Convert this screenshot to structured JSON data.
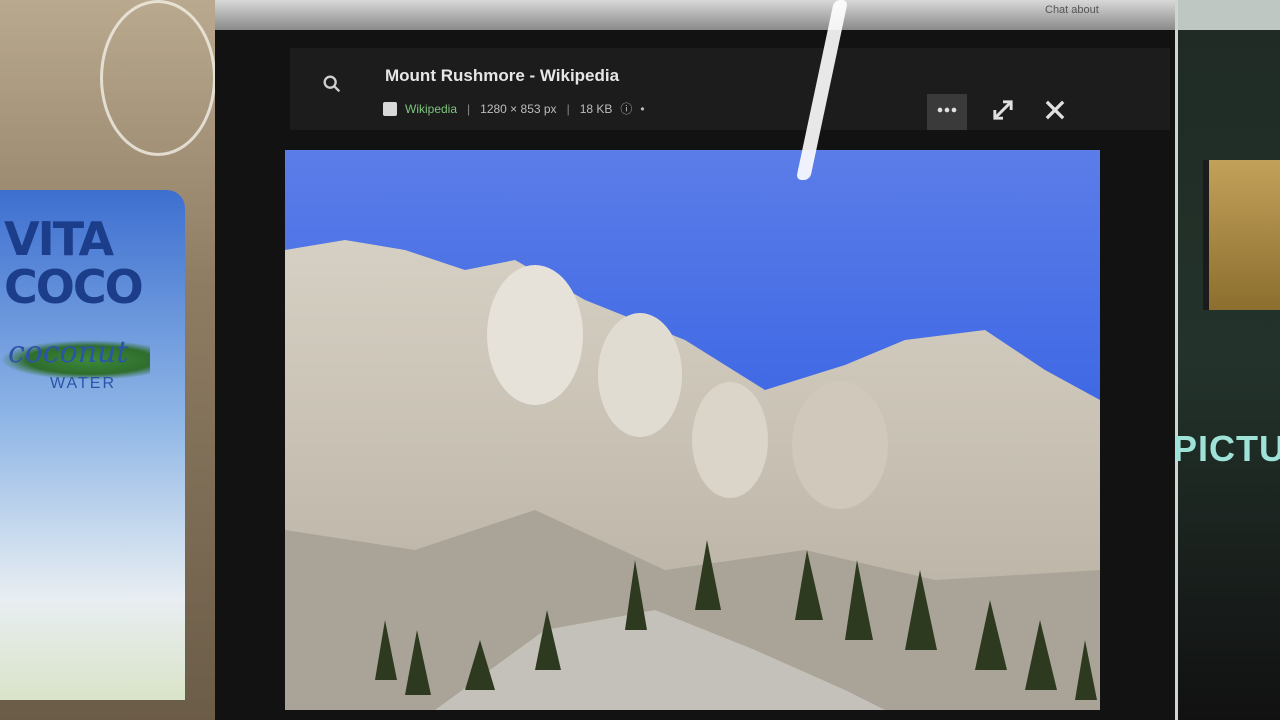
{
  "viewer": {
    "title": "Mount Rushmore - Wikipedia",
    "source": "Wikipedia",
    "dimensions": "1280 × 853 px",
    "size": "18 KB",
    "search_icon": "search-icon",
    "more_icon": "more-icon",
    "expand_icon": "expand-icon",
    "close_icon": "close-icon",
    "next_icon": "chevron-right-icon"
  },
  "browser": {
    "top_right_text": "Chat about"
  },
  "right_page": {
    "label": "PICTUR"
  },
  "desk": {
    "carton_brand": "VITA COCO",
    "carton_sub": "coconut",
    "carton_water": "WATER"
  },
  "colors": {
    "viewer_bar": "#1c1c1c",
    "sky": "#1f52e0",
    "source_green": "#7fc47f"
  }
}
